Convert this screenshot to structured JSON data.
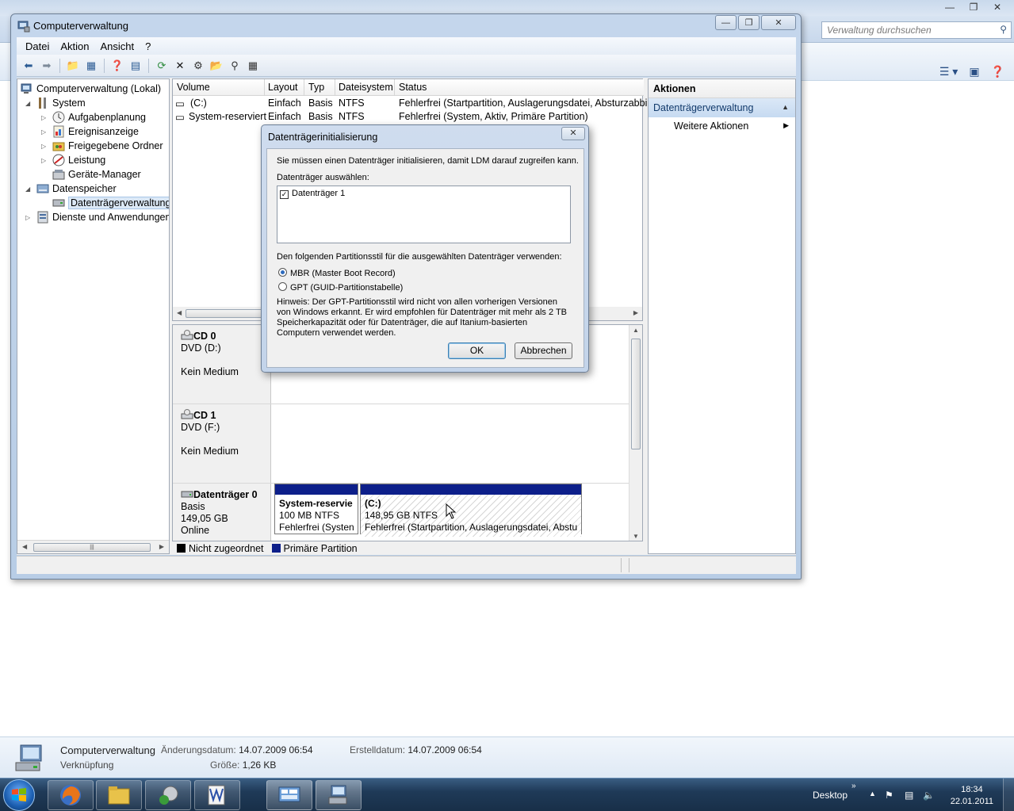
{
  "bg_explorer": {
    "search_placeholder": "Verwaltung durchsuchen"
  },
  "window": {
    "title": "Computerverwaltung"
  },
  "menu": [
    "Datei",
    "Aktion",
    "Ansicht",
    "?"
  ],
  "tree": {
    "items": [
      {
        "label": "Computerverwaltung (Lokal)",
        "icon": "computer-icon"
      },
      {
        "label": "System",
        "icon": "tools-icon"
      },
      {
        "label": "Aufgabenplanung",
        "icon": "clock-icon"
      },
      {
        "label": "Ereignisanzeige",
        "icon": "event-log-icon"
      },
      {
        "label": "Freigegebene Ordner",
        "icon": "shared-folder-icon"
      },
      {
        "label": "Leistung",
        "icon": "performance-icon"
      },
      {
        "label": "Geräte-Manager",
        "icon": "device-manager-icon"
      },
      {
        "label": "Datenspeicher",
        "icon": "storage-icon"
      },
      {
        "label": "Datenträgerverwaltung",
        "icon": "disk-management-icon"
      },
      {
        "label": "Dienste und Anwendungen",
        "icon": "services-icon"
      }
    ]
  },
  "volumes": {
    "columns": [
      "Volume",
      "Layout",
      "Typ",
      "Dateisystem",
      "Status"
    ],
    "rows": [
      {
        "volume": "(C:)",
        "layout": "Einfach",
        "type": "Basis",
        "fs": "NTFS",
        "status": "Fehlerfrei (Startpartition, Auslagerungsdatei, Absturzabbild"
      },
      {
        "volume": "System-reserviert",
        "layout": "Einfach",
        "type": "Basis",
        "fs": "NTFS",
        "status": "Fehlerfrei (System, Aktiv, Primäre Partition)"
      }
    ]
  },
  "disks": {
    "cd0": {
      "name": "CD 0",
      "drive": "DVD (D:)",
      "media": "Kein Medium"
    },
    "cd1": {
      "name": "CD 1",
      "drive": "DVD (F:)",
      "media": "Kein Medium"
    },
    "disk0": {
      "name": "Datenträger 0",
      "type": "Basis",
      "size": "149,05 GB",
      "state": "Online",
      "partitions": [
        {
          "title": "System-reservie",
          "size": "100 MB NTFS",
          "status": "Fehlerfrei (Systen"
        },
        {
          "title": "(C:)",
          "size": "148,95 GB NTFS",
          "status": "Fehlerfrei (Startpartition, Auslagerungsdatei, Abstu"
        }
      ]
    }
  },
  "legend": {
    "unallocated": "Nicht zugeordnet",
    "primary": "Primäre Partition",
    "unallocated_color": "#000000",
    "primary_color": "#0d1f8a"
  },
  "actions": {
    "header": "Aktionen",
    "section": "Datenträgerverwaltung",
    "item": "Weitere Aktionen"
  },
  "dialog": {
    "title": "Datenträgerinitialisierung",
    "intro": "Sie müssen einen Datenträger initialisieren, damit LDM darauf zugreifen kann.",
    "select_label": "Datenträger auswählen:",
    "disk_item": "Datenträger 1",
    "disk_checked": true,
    "style_label": "Den folgenden Partitionsstil für die ausgewählten Datenträger verwenden:",
    "option_mbr": "MBR (Master Boot Record)",
    "option_gpt": "GPT (GUID-Partitionstabelle)",
    "selected_option": "MBR",
    "note": "Hinweis: Der GPT-Partitionsstil wird nicht von allen vorherigen Versionen von Windows erkannt. Er wird empfohlen für Datenträger mit mehr als 2 TB Speicherkapazität oder für Datenträger, die auf Itanium-basierten Computern verwendet werden.",
    "ok": "OK",
    "cancel": "Abbrechen"
  },
  "details_pane": {
    "name": "Computerverwaltung",
    "type": "Verknüpfung",
    "modified_label": "Änderungsdatum:",
    "modified_value": "14.07.2009 06:54",
    "created_label": "Erstelldatum:",
    "created_value": "14.07.2009 06:54",
    "size_label": "Größe:",
    "size_value": "1,26 KB"
  },
  "taskbar": {
    "desktop_label": "Desktop",
    "time": "18:34",
    "date": "22.01.2011"
  }
}
